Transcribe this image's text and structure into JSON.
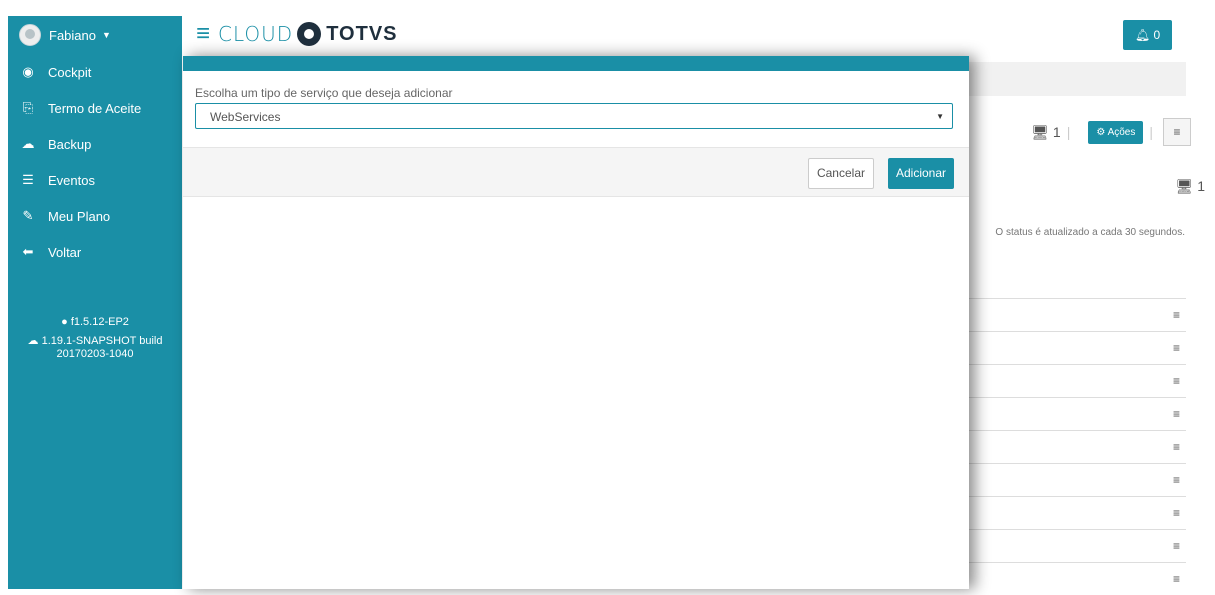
{
  "sidebar": {
    "user_name": "Fabiano",
    "items": [
      {
        "label": "Cockpit",
        "icon": "dashboard-icon",
        "glyph": "◉"
      },
      {
        "label": "Termo de Aceite",
        "icon": "document-icon",
        "glyph": "⎘"
      },
      {
        "label": "Backup",
        "icon": "cloud-upload-icon",
        "glyph": "☁"
      },
      {
        "label": "Eventos",
        "icon": "list-icon",
        "glyph": "☰"
      },
      {
        "label": "Meu Plano",
        "icon": "edit-icon",
        "glyph": "✎"
      },
      {
        "label": "Voltar",
        "icon": "arrow-left-icon",
        "glyph": "⬅"
      }
    ],
    "version_front": "f1.5.12-EP2",
    "version_back_line1": "1.19.1-SNAPSHOT build",
    "version_back_line2": "20170203-1040"
  },
  "header": {
    "logo_cloud": "CLOUD",
    "logo_brand": "TOTVS",
    "notifications_count": "0"
  },
  "background": {
    "count": "1",
    "actions_label": "Ações",
    "status_text": "O status é atualizado a cada 30 segundos."
  },
  "modal": {
    "field_label": "Escolha um tipo de serviço que deseja adicionar",
    "selected_service": "WebServices",
    "cancel_label": "Cancelar",
    "add_label": "Adicionar"
  },
  "colors": {
    "accent": "#1a8fa6",
    "brand_dark": "#1f2f3d"
  }
}
